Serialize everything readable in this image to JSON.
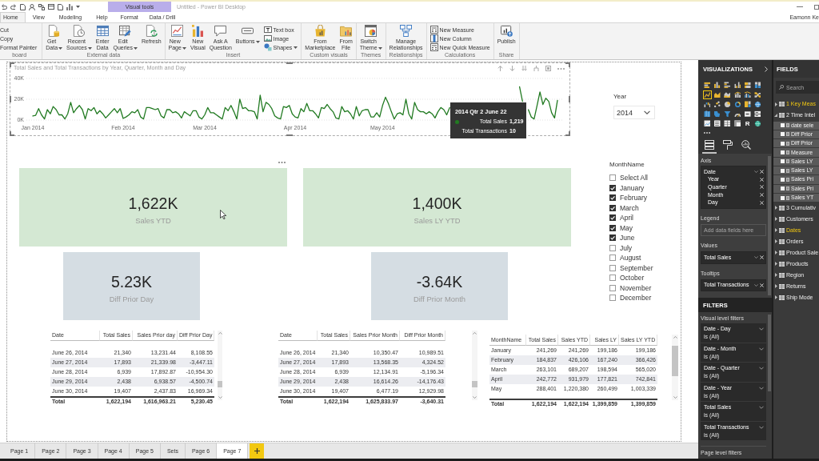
{
  "window": {
    "title": "Untitled - Power BI Desktop",
    "user": "Eamonn Ke"
  },
  "tabs": [
    {
      "label": "Home",
      "selected": true
    },
    {
      "label": "View",
      "selected": false
    },
    {
      "label": "Modeling",
      "selected": false
    },
    {
      "label": "Help",
      "selected": false
    }
  ],
  "context_tabs": {
    "title": "Visual tools",
    "tabs": [
      {
        "label": "Format",
        "selected": false
      },
      {
        "label": "Data / Drill",
        "selected": false
      }
    ]
  },
  "ribbon": [
    {
      "label": "board",
      "items": [
        {
          "kind": "plain",
          "label": "Cut"
        },
        {
          "kind": "plain",
          "label": "Copy"
        },
        {
          "kind": "plain",
          "label": "Format Painter"
        }
      ]
    },
    {
      "label": "External data",
      "items": [
        {
          "kind": "large",
          "label": "Get Data",
          "dropdown": true
        },
        {
          "kind": "large",
          "label": "Recent Sources",
          "dropdown": true
        },
        {
          "kind": "large",
          "label": "Enter Data",
          "dropdown": false
        },
        {
          "kind": "large",
          "label": "Edit Queries",
          "dropdown": true
        },
        {
          "kind": "large",
          "label": "Refresh",
          "dropdown": false
        }
      ]
    },
    {
      "label": "Insert",
      "items": [
        {
          "kind": "large",
          "label": "New Page",
          "dropdown": true
        },
        {
          "kind": "large",
          "label": "New Visual",
          "dropdown": false
        },
        {
          "kind": "large",
          "label": "Ask A Question",
          "dropdown": false
        },
        {
          "kind": "large",
          "label": "Buttons",
          "dropdown": true
        },
        {
          "kind": "small",
          "label": "Text box",
          "dropdown": false
        },
        {
          "kind": "small",
          "label": "Image",
          "dropdown": false
        },
        {
          "kind": "small",
          "label": "Shapes",
          "dropdown": true
        }
      ]
    },
    {
      "label": "Custom visuals",
      "items": [
        {
          "kind": "large",
          "label": "From Marketplace",
          "dropdown": false
        },
        {
          "kind": "large",
          "label": "From File",
          "dropdown": false
        }
      ]
    },
    {
      "label": "Themes",
      "items": [
        {
          "kind": "large",
          "label": "Switch Theme",
          "dropdown": true
        }
      ]
    },
    {
      "label": "Relationships",
      "items": [
        {
          "kind": "large",
          "label": "Manage Relationships",
          "dropdown": false
        }
      ]
    },
    {
      "label": "Calculations",
      "items": [
        {
          "kind": "small",
          "label": "New Measure",
          "dropdown": false
        },
        {
          "kind": "small",
          "label": "New Column",
          "dropdown": false
        },
        {
          "kind": "small",
          "label": "New Quick Measure",
          "dropdown": false
        }
      ]
    },
    {
      "label": "Share",
      "items": [
        {
          "kind": "large",
          "label": "Publish",
          "dropdown": false
        }
      ]
    }
  ],
  "report": {
    "chart": {
      "chart_data": {
        "type": "line",
        "title": "Total Sales and Total Transactions by Year, Quarter, Month and Day",
        "categories": [
          "Jan 2014",
          null,
          null,
          null,
          null,
          null,
          null,
          null,
          null,
          null,
          null,
          null,
          null,
          null,
          null,
          null,
          null,
          null,
          null,
          null,
          null,
          null,
          null,
          null,
          null,
          null,
          null,
          null,
          null,
          null,
          null,
          "Feb 2014",
          null,
          null,
          null,
          null,
          null,
          null,
          null,
          null,
          null,
          null,
          null,
          null,
          null,
          null,
          null,
          null,
          null,
          null,
          null,
          null,
          null,
          null,
          null,
          null,
          null,
          null,
          null,
          "Mar 2014",
          null,
          null,
          null,
          null,
          null,
          null,
          null,
          null,
          null,
          null,
          null,
          null,
          null,
          null,
          null,
          null,
          null,
          null,
          null,
          null,
          null,
          null,
          null,
          null,
          null,
          null,
          null,
          null,
          null,
          null,
          "Apr 2014",
          null,
          null,
          null,
          null,
          null,
          null,
          null,
          null,
          null,
          null,
          null,
          null,
          null,
          null,
          null,
          null,
          null,
          null,
          null,
          null,
          null,
          null,
          null,
          null,
          null,
          null,
          null,
          null,
          null,
          "May 2014",
          null,
          null,
          null,
          null,
          null,
          null,
          null,
          null,
          null,
          null,
          null,
          null,
          null,
          null,
          null,
          null,
          null,
          null,
          null,
          null,
          null,
          null,
          null,
          null,
          null,
          null,
          null,
          null,
          null,
          null,
          null,
          null,
          null,
          null,
          null,
          null,
          null,
          null,
          null,
          null,
          null,
          null,
          null,
          null,
          null,
          null,
          null,
          null,
          null,
          null,
          null,
          null,
          null,
          null,
          null,
          null,
          null,
          null,
          null,
          null
        ],
        "ylim": [
          0,
          40000
        ],
        "yticks": [
          {
            "value": 0,
            "label": "0K"
          },
          {
            "value": 20000,
            "label": "20K"
          },
          {
            "value": 40000,
            "label": "40K"
          }
        ],
        "series": [
          {
            "color": "#217a21",
            "values": [
              4000,
              4500,
              11000,
              5000,
              1000,
              10000,
              6000,
              13000,
              10000,
              5000,
              5000,
              1000,
              6000,
              17000,
              7000,
              11000,
              14000,
              10000,
              1000,
              11000,
              9000,
              12000,
              6000,
              9000,
              6000,
              2000,
              5000,
              8000,
              11000,
              7000,
              11000,
              1500,
              3000,
              5000,
              8000,
              7000,
              10000,
              3000,
              1000,
              12000,
              12000,
              11000,
              10000,
              11000,
              4000,
              2000,
              10000,
              10000,
              7000,
              8000,
              6000,
              2000,
              8000,
              6000,
              4000,
              9000,
              9000,
              3000,
              1000,
              5000,
              12000,
              7000,
              7000,
              5000,
              3000,
              1000,
              12000,
              9000,
              14000,
              8000,
              1000,
              20000,
              11000,
              12000,
              9000,
              9000,
              8000,
              1000,
              24000,
              8000,
              17000,
              15000,
              11000,
              4000,
              2000,
              1000,
              13000,
              12000,
              14000,
              6000,
              3000,
              2000,
              11000,
              8000,
              16000,
              9000,
              9000,
              6000,
              2000,
              12000,
              11000,
              15000,
              11000,
              8000,
              2000,
              1000,
              13000,
              8000,
              9000,
              6000,
              1000,
              13000,
              4000,
              9000,
              10000,
              10000,
              3000,
              3000,
              7000,
              3000,
              14000,
              22000,
              16000,
              8000,
              1000,
              6000,
              7000,
              5000,
              20000,
              6000,
              1000,
              17000,
              10000,
              8000,
              8000,
              6000,
              8000,
              6000,
              2000,
              8000,
              12000,
              10000,
              5000,
              12000,
              null,
              null,
              null,
              null,
              null,
              null,
              null,
              null,
              null,
              null,
              null,
              null,
              null,
              null,
              null,
              null,
              null,
              null,
              null,
              null,
              null,
              null,
              null,
              32000,
              18000,
              null,
              10000,
              3000,
              1000,
              14000,
              27000,
              15000,
              21000,
              18000,
              7000,
              2000,
              19000
            ]
          }
        ]
      },
      "tooltip": {
        "title": "2014 Qtr 2 June 22",
        "rows": [
          {
            "label": "Total Sales",
            "value": "1,219"
          },
          {
            "label": "Total Transactions",
            "value": "10"
          }
        ]
      }
    },
    "year_slicer": {
      "title": "Year",
      "value": "2014"
    },
    "cards": [
      {
        "value": "1,622K",
        "label": "Sales YTD",
        "color": "#d4e8d3"
      },
      {
        "value": "1,400K",
        "label": "Sales LY YTD",
        "color": "#d4e8d3"
      },
      {
        "value": "5.23K",
        "label": "Diff Prior Day",
        "color": "#d5dde3"
      },
      {
        "value": "-3.64K",
        "label": "Diff Prior Month",
        "color": "#d5dde3"
      }
    ],
    "month_slicer": {
      "title": "MonthName",
      "items": [
        {
          "label": "Select All",
          "checked": false
        },
        {
          "label": "January",
          "checked": true
        },
        {
          "label": "February",
          "checked": true
        },
        {
          "label": "March",
          "checked": true
        },
        {
          "label": "April",
          "checked": true
        },
        {
          "label": "May",
          "checked": true
        },
        {
          "label": "June",
          "checked": true
        },
        {
          "label": "July",
          "checked": false
        },
        {
          "label": "August",
          "checked": false
        },
        {
          "label": "September",
          "checked": false
        },
        {
          "label": "October",
          "checked": false
        },
        {
          "label": "November",
          "checked": false
        },
        {
          "label": "December",
          "checked": false
        }
      ]
    },
    "tables": [
      {
        "columns": [
          "Date",
          "Total Sales",
          "Sales Prior day",
          "Diff Prior Day"
        ],
        "rows": [
          [
            "June 26, 2014",
            "21,340",
            "13,231.44",
            "8,108.55"
          ],
          [
            "June 27, 2014",
            "17,893",
            "21,339.98",
            "-3,447.11"
          ],
          [
            "June 28, 2014",
            "6,939",
            "17,892.87",
            "-10,954.30"
          ],
          [
            "June 29, 2014",
            "2,438",
            "6,938.57",
            "-4,500.74"
          ],
          [
            "June 30, 2014",
            "19,407",
            "2,437.83",
            "16,969.34"
          ]
        ],
        "total": [
          "Total",
          "1,622,194",
          "1,616,963.21",
          "5,230.45"
        ]
      },
      {
        "columns": [
          "Date",
          "Total Sales",
          "Sales Prior Month",
          "Diff Prior Month"
        ],
        "rows": [
          [
            "June 26, 2014",
            "21,340",
            "10,350.47",
            "10,989.51"
          ],
          [
            "June 27, 2014",
            "17,893",
            "13,568.35",
            "4,324.52"
          ],
          [
            "June 28, 2014",
            "6,939",
            "12,134.91",
            "-5,196.34"
          ],
          [
            "June 29, 2014",
            "2,438",
            "16,614.26",
            "-14,176.43"
          ],
          [
            "June 30, 2014",
            "19,407",
            "6,477.19",
            "12,929.98"
          ]
        ],
        "total": [
          "Total",
          "1,622,194",
          "1,625,833.97",
          "-3,640.31"
        ]
      },
      {
        "columns": [
          "MonthName",
          "Total Sales",
          "Sales YTD",
          "Sales LY",
          "Sales LY YTD"
        ],
        "rows": [
          [
            "January",
            "241,269",
            "241,269",
            "199,186",
            "199,186"
          ],
          [
            "February",
            "184,837",
            "426,106",
            "167,240",
            "366,426"
          ],
          [
            "March",
            "263,101",
            "689,207",
            "198,594",
            "565,020"
          ],
          [
            "April",
            "242,772",
            "931,979",
            "177,821",
            "742,841"
          ],
          [
            "May",
            "288,401",
            "1,220,380",
            "260,499",
            "1,003,339"
          ]
        ],
        "total": [
          "Total",
          "1,622,194",
          "1,622,194",
          "1,399,859",
          "1,399,859"
        ]
      }
    ]
  },
  "pages": [
    {
      "label": "Page 1",
      "selected": false
    },
    {
      "label": "Page 2",
      "selected": false
    },
    {
      "label": "Page 3",
      "selected": false
    },
    {
      "label": "Page 4",
      "selected": false
    },
    {
      "label": "Page 5",
      "selected": false
    },
    {
      "label": "Sets",
      "selected": false
    },
    {
      "label": "Page 6",
      "selected": false
    },
    {
      "label": "Page 7",
      "selected": true
    }
  ],
  "visualizations": {
    "title": "VISUALIZATIONS",
    "gallery": [
      {
        "selected": false
      },
      {
        "selected": false
      },
      {
        "selected": false
      },
      {
        "selected": false
      },
      {
        "selected": false
      },
      {
        "selected": false
      },
      {
        "selected": true
      },
      {
        "selected": false
      },
      {
        "selected": false
      },
      {
        "selected": false
      },
      {
        "selected": false
      },
      {
        "selected": false
      },
      {
        "selected": false
      },
      {
        "selected": false
      },
      {
        "selected": false
      },
      {
        "selected": false
      },
      {
        "selected": false
      },
      {
        "selected": false
      },
      {
        "selected": false
      },
      {
        "selected": false
      },
      {
        "selected": false
      },
      {
        "selected": false
      },
      {
        "selected": false
      },
      {
        "selected": false
      },
      {
        "selected": false
      },
      {
        "selected": false
      },
      {
        "selected": false
      },
      {
        "selected": false
      },
      {
        "selected": false,
        "label": "R"
      },
      {
        "selected": false
      }
    ],
    "pane_tabs": [
      {
        "selected": true
      },
      {
        "selected": false
      },
      {
        "selected": false
      }
    ],
    "wells": [
      {
        "label": "Axis",
        "fields": [
          {
            "name": "Date",
            "children": [
              {
                "name": "Year"
              },
              {
                "name": "Quarter"
              },
              {
                "name": "Month"
              },
              {
                "name": "Day"
              }
            ]
          }
        ]
      },
      {
        "label": "Legend",
        "placeholder": "Add data fields here"
      },
      {
        "label": "Values",
        "fields": [
          {
            "name": "Total Sales"
          }
        ]
      },
      {
        "label": "Tooltips",
        "fields": [
          {
            "name": "Total Transactions"
          }
        ]
      }
    ]
  },
  "filters": {
    "title": "FILTERS",
    "visual_label": "Visual level filters",
    "items": [
      {
        "field": "Date - Day",
        "condition": "is (All)"
      },
      {
        "field": "Date - Month",
        "condition": "is (All)"
      },
      {
        "field": "Date - Quarter",
        "condition": "is (All)"
      },
      {
        "field": "Date - Year",
        "condition": "is (All)"
      },
      {
        "field": "Total Sales",
        "condition": "is (All)"
      },
      {
        "field": "Total Transactions",
        "condition": "is (All)"
      }
    ],
    "page_label": "Page level filters"
  },
  "fields": {
    "title": "FIELDS",
    "search": {
      "placeholder": "Search"
    },
    "tables": [
      {
        "name": "1 Key Meas",
        "expanded": false,
        "highlighted": true
      },
      {
        "name": "2 Time Intel",
        "expanded": true,
        "highlighted": false,
        "children": [
          {
            "name": "date sele",
            "checked": false
          },
          {
            "name": "Diff Prior",
            "checked": false
          },
          {
            "name": "Diff Prior",
            "checked": false
          },
          {
            "name": "Measure",
            "checked": false
          },
          {
            "name": "Sales LY",
            "checked": false
          },
          {
            "name": "Sales LY",
            "checked": false
          },
          {
            "name": "Sales Pri",
            "checked": false
          },
          {
            "name": "Sales Pri",
            "checked": false
          },
          {
            "name": "Sales YT",
            "checked": false
          }
        ]
      },
      {
        "name": "3 Cumulativ",
        "expanded": false,
        "highlighted": false
      },
      {
        "name": "Customers",
        "expanded": false,
        "highlighted": false
      },
      {
        "name": "Dates",
        "expanded": false,
        "highlighted": true
      },
      {
        "name": "Orders",
        "expanded": false,
        "highlighted": false
      },
      {
        "name": "Product Sale",
        "expanded": false,
        "highlighted": false
      },
      {
        "name": "Products",
        "expanded": false,
        "highlighted": false
      },
      {
        "name": "Region",
        "expanded": false,
        "highlighted": false
      },
      {
        "name": "Returns",
        "expanded": false,
        "highlighted": false
      },
      {
        "name": "Ship Mode",
        "expanded": false,
        "highlighted": false
      }
    ]
  }
}
